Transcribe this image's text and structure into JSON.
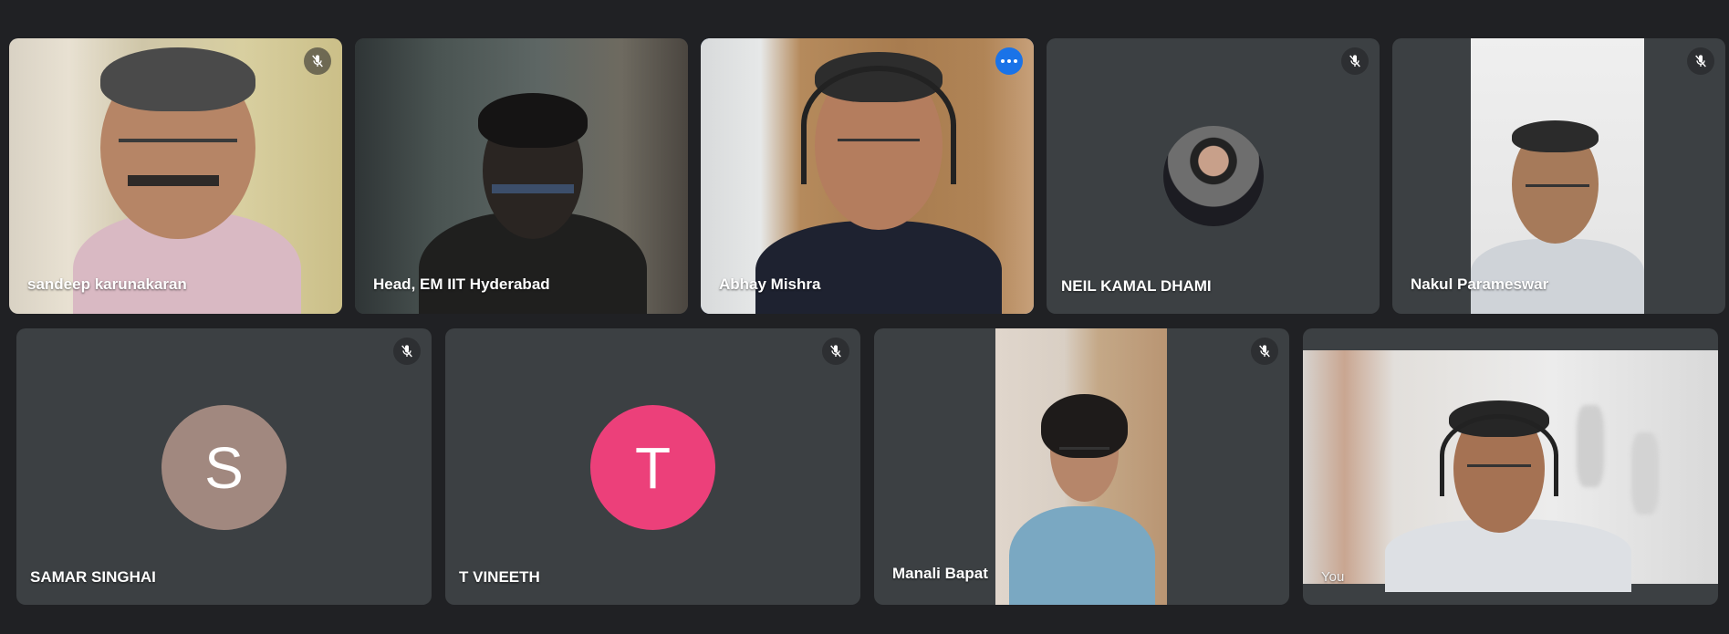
{
  "participants": [
    {
      "name": "sandeep karunakaran",
      "muted": true
    },
    {
      "name": "Head, EM IIT Hyderabad",
      "muted": false
    },
    {
      "name": "Abhay Mishra",
      "muted": false,
      "active": true
    },
    {
      "name": "NEIL KAMAL DHAMI",
      "muted": true
    },
    {
      "name": "Nakul Parameswar",
      "muted": true
    },
    {
      "name": "SAMAR SINGHAI",
      "muted": true,
      "avatar_letter": "S",
      "avatar_color": "#a1887f"
    },
    {
      "name": "T VINEETH",
      "muted": true,
      "avatar_letter": "T",
      "avatar_color": "#ec407a"
    },
    {
      "name": "Manali Bapat",
      "muted": true
    },
    {
      "name": "You",
      "muted": false
    }
  ],
  "icons": {
    "mic_off": "mic-off-icon",
    "more": "more-options-icon"
  },
  "colors": {
    "background": "#202124",
    "tile": "#3c4043",
    "active_border": "#8ab4f8",
    "more_button": "#1a73e8"
  }
}
